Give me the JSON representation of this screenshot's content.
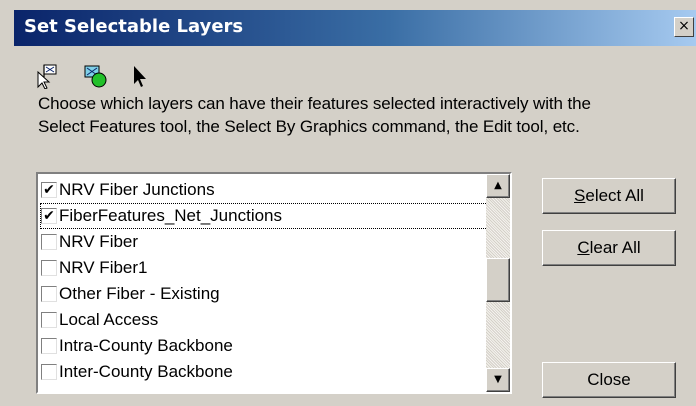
{
  "window": {
    "title": "Set Selectable Layers",
    "close_glyph": "×"
  },
  "toolbar": {
    "icons": [
      "select-features-icon",
      "select-by-graphics-icon",
      "edit-tool-icon"
    ]
  },
  "description": {
    "line1": "Choose which layers can have their features selected interactively with the",
    "line2": "Select Features tool, the Select By Graphics command, the Edit tool, etc."
  },
  "layers": [
    {
      "label": "NRV Fiber Junctions",
      "checked": true
    },
    {
      "label": "FiberFeatures_Net_Junctions",
      "checked": true,
      "focused": true
    },
    {
      "label": "NRV Fiber",
      "checked": false
    },
    {
      "label": "NRV Fiber1",
      "checked": false
    },
    {
      "label": "Other Fiber - Existing",
      "checked": false
    },
    {
      "label": "Local Access",
      "checked": false
    },
    {
      "label": "Intra-County Backbone",
      "checked": false
    },
    {
      "label": "Inter-County Backbone",
      "checked": false
    }
  ],
  "scrollbar": {
    "up_glyph": "▲",
    "down_glyph": "▼"
  },
  "buttons": {
    "select_all": {
      "mnemonic": "S",
      "rest": "elect All"
    },
    "clear_all": {
      "mnemonic": "C",
      "rest": "lear All"
    },
    "close": "Close"
  },
  "colors": {
    "title_bar_start": "#0a246a",
    "title_bar_end": "#a6caf0",
    "dialog_face": "#d4d0c8"
  }
}
